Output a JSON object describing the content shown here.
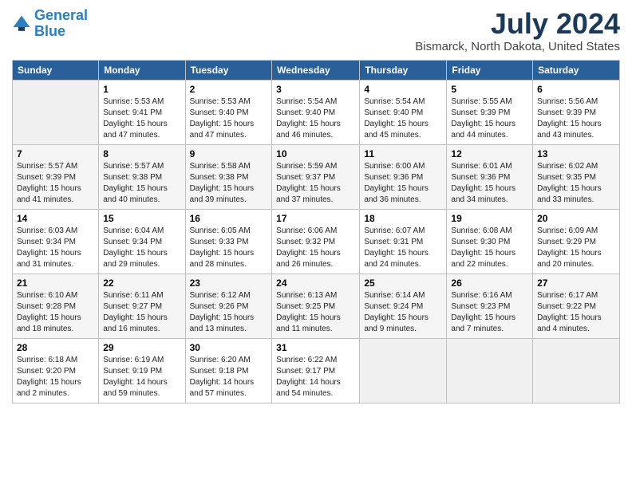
{
  "header": {
    "logo_line1": "General",
    "logo_line2": "Blue",
    "title": "July 2024",
    "subtitle": "Bismarck, North Dakota, United States"
  },
  "columns": [
    "Sunday",
    "Monday",
    "Tuesday",
    "Wednesday",
    "Thursday",
    "Friday",
    "Saturday"
  ],
  "weeks": [
    [
      {
        "day": "",
        "sunrise": "",
        "sunset": "",
        "daylight": ""
      },
      {
        "day": "1",
        "sunrise": "Sunrise: 5:53 AM",
        "sunset": "Sunset: 9:41 PM",
        "daylight": "Daylight: 15 hours and 47 minutes."
      },
      {
        "day": "2",
        "sunrise": "Sunrise: 5:53 AM",
        "sunset": "Sunset: 9:40 PM",
        "daylight": "Daylight: 15 hours and 47 minutes."
      },
      {
        "day": "3",
        "sunrise": "Sunrise: 5:54 AM",
        "sunset": "Sunset: 9:40 PM",
        "daylight": "Daylight: 15 hours and 46 minutes."
      },
      {
        "day": "4",
        "sunrise": "Sunrise: 5:54 AM",
        "sunset": "Sunset: 9:40 PM",
        "daylight": "Daylight: 15 hours and 45 minutes."
      },
      {
        "day": "5",
        "sunrise": "Sunrise: 5:55 AM",
        "sunset": "Sunset: 9:39 PM",
        "daylight": "Daylight: 15 hours and 44 minutes."
      },
      {
        "day": "6",
        "sunrise": "Sunrise: 5:56 AM",
        "sunset": "Sunset: 9:39 PM",
        "daylight": "Daylight: 15 hours and 43 minutes."
      }
    ],
    [
      {
        "day": "7",
        "sunrise": "Sunrise: 5:57 AM",
        "sunset": "Sunset: 9:39 PM",
        "daylight": "Daylight: 15 hours and 41 minutes."
      },
      {
        "day": "8",
        "sunrise": "Sunrise: 5:57 AM",
        "sunset": "Sunset: 9:38 PM",
        "daylight": "Daylight: 15 hours and 40 minutes."
      },
      {
        "day": "9",
        "sunrise": "Sunrise: 5:58 AM",
        "sunset": "Sunset: 9:38 PM",
        "daylight": "Daylight: 15 hours and 39 minutes."
      },
      {
        "day": "10",
        "sunrise": "Sunrise: 5:59 AM",
        "sunset": "Sunset: 9:37 PM",
        "daylight": "Daylight: 15 hours and 37 minutes."
      },
      {
        "day": "11",
        "sunrise": "Sunrise: 6:00 AM",
        "sunset": "Sunset: 9:36 PM",
        "daylight": "Daylight: 15 hours and 36 minutes."
      },
      {
        "day": "12",
        "sunrise": "Sunrise: 6:01 AM",
        "sunset": "Sunset: 9:36 PM",
        "daylight": "Daylight: 15 hours and 34 minutes."
      },
      {
        "day": "13",
        "sunrise": "Sunrise: 6:02 AM",
        "sunset": "Sunset: 9:35 PM",
        "daylight": "Daylight: 15 hours and 33 minutes."
      }
    ],
    [
      {
        "day": "14",
        "sunrise": "Sunrise: 6:03 AM",
        "sunset": "Sunset: 9:34 PM",
        "daylight": "Daylight: 15 hours and 31 minutes."
      },
      {
        "day": "15",
        "sunrise": "Sunrise: 6:04 AM",
        "sunset": "Sunset: 9:34 PM",
        "daylight": "Daylight: 15 hours and 29 minutes."
      },
      {
        "day": "16",
        "sunrise": "Sunrise: 6:05 AM",
        "sunset": "Sunset: 9:33 PM",
        "daylight": "Daylight: 15 hours and 28 minutes."
      },
      {
        "day": "17",
        "sunrise": "Sunrise: 6:06 AM",
        "sunset": "Sunset: 9:32 PM",
        "daylight": "Daylight: 15 hours and 26 minutes."
      },
      {
        "day": "18",
        "sunrise": "Sunrise: 6:07 AM",
        "sunset": "Sunset: 9:31 PM",
        "daylight": "Daylight: 15 hours and 24 minutes."
      },
      {
        "day": "19",
        "sunrise": "Sunrise: 6:08 AM",
        "sunset": "Sunset: 9:30 PM",
        "daylight": "Daylight: 15 hours and 22 minutes."
      },
      {
        "day": "20",
        "sunrise": "Sunrise: 6:09 AM",
        "sunset": "Sunset: 9:29 PM",
        "daylight": "Daylight: 15 hours and 20 minutes."
      }
    ],
    [
      {
        "day": "21",
        "sunrise": "Sunrise: 6:10 AM",
        "sunset": "Sunset: 9:28 PM",
        "daylight": "Daylight: 15 hours and 18 minutes."
      },
      {
        "day": "22",
        "sunrise": "Sunrise: 6:11 AM",
        "sunset": "Sunset: 9:27 PM",
        "daylight": "Daylight: 15 hours and 16 minutes."
      },
      {
        "day": "23",
        "sunrise": "Sunrise: 6:12 AM",
        "sunset": "Sunset: 9:26 PM",
        "daylight": "Daylight: 15 hours and 13 minutes."
      },
      {
        "day": "24",
        "sunrise": "Sunrise: 6:13 AM",
        "sunset": "Sunset: 9:25 PM",
        "daylight": "Daylight: 15 hours and 11 minutes."
      },
      {
        "day": "25",
        "sunrise": "Sunrise: 6:14 AM",
        "sunset": "Sunset: 9:24 PM",
        "daylight": "Daylight: 15 hours and 9 minutes."
      },
      {
        "day": "26",
        "sunrise": "Sunrise: 6:16 AM",
        "sunset": "Sunset: 9:23 PM",
        "daylight": "Daylight: 15 hours and 7 minutes."
      },
      {
        "day": "27",
        "sunrise": "Sunrise: 6:17 AM",
        "sunset": "Sunset: 9:22 PM",
        "daylight": "Daylight: 15 hours and 4 minutes."
      }
    ],
    [
      {
        "day": "28",
        "sunrise": "Sunrise: 6:18 AM",
        "sunset": "Sunset: 9:20 PM",
        "daylight": "Daylight: 15 hours and 2 minutes."
      },
      {
        "day": "29",
        "sunrise": "Sunrise: 6:19 AM",
        "sunset": "Sunset: 9:19 PM",
        "daylight": "Daylight: 14 hours and 59 minutes."
      },
      {
        "day": "30",
        "sunrise": "Sunrise: 6:20 AM",
        "sunset": "Sunset: 9:18 PM",
        "daylight": "Daylight: 14 hours and 57 minutes."
      },
      {
        "day": "31",
        "sunrise": "Sunrise: 6:22 AM",
        "sunset": "Sunset: 9:17 PM",
        "daylight": "Daylight: 14 hours and 54 minutes."
      },
      {
        "day": "",
        "sunrise": "",
        "sunset": "",
        "daylight": ""
      },
      {
        "day": "",
        "sunrise": "",
        "sunset": "",
        "daylight": ""
      },
      {
        "day": "",
        "sunrise": "",
        "sunset": "",
        "daylight": ""
      }
    ]
  ]
}
